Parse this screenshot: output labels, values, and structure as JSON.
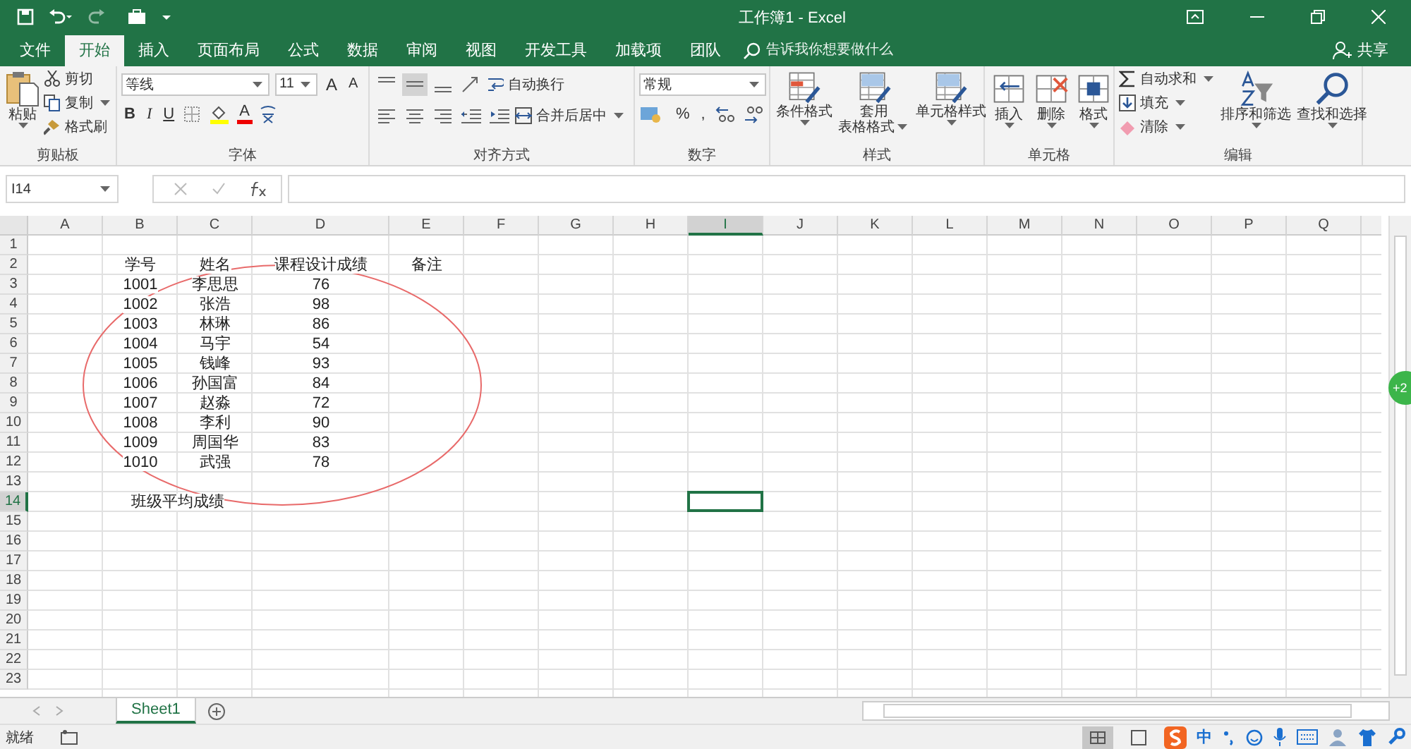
{
  "title_bar": {
    "title": "工作簿1  -  Excel"
  },
  "ribbon_tabs": [
    {
      "label": "文件",
      "selected": false
    },
    {
      "label": "开始",
      "selected": true
    },
    {
      "label": "插入",
      "selected": false
    },
    {
      "label": "页面布局",
      "selected": false
    },
    {
      "label": "公式",
      "selected": false
    },
    {
      "label": "数据",
      "selected": false
    },
    {
      "label": "审阅",
      "selected": false
    },
    {
      "label": "视图",
      "selected": false
    },
    {
      "label": "开发工具",
      "selected": false
    },
    {
      "label": "加载项",
      "selected": false
    },
    {
      "label": "团队",
      "selected": false
    }
  ],
  "tell_me": {
    "placeholder": "告诉我你想要做什么"
  },
  "share": "共享",
  "ribbon": {
    "groups": [
      {
        "kind": "clipboard",
        "label": "剪贴板",
        "big": "粘贴",
        "items": [
          "剪切",
          "复制",
          "格式刷"
        ]
      },
      {
        "kind": "font",
        "label": "字体",
        "font": "等线",
        "size": "11",
        "size_buttons": [
          "A",
          "A"
        ],
        "format_buttons": [
          "B",
          "I",
          "U"
        ],
        "color_button": "A"
      },
      {
        "kind": "alignment",
        "label": "对齐方式",
        "wrap": "自动换行",
        "merge": "合并后居中"
      },
      {
        "kind": "number",
        "label": "数字",
        "format": "常规",
        "percent": "%",
        "comma": ","
      },
      {
        "kind": "styles",
        "label": "样式",
        "buttons": [
          {
            "lines": [
              "条件格式"
            ]
          },
          {
            "lines": [
              "套用",
              "表格格式"
            ]
          },
          {
            "lines": [
              "单元格样式"
            ]
          }
        ]
      },
      {
        "kind": "cells",
        "label": "单元格",
        "buttons": [
          "插入",
          "删除",
          "格式"
        ]
      },
      {
        "kind": "editing",
        "label": "编辑",
        "items": [
          "自动求和",
          "填充",
          "清除"
        ],
        "buttons": [
          "排序和筛选",
          "查找和选择"
        ]
      }
    ]
  },
  "formula_bar": {
    "name_box": "I14"
  },
  "columns": [
    {
      "label": "A",
      "selected": false
    },
    {
      "label": "B",
      "selected": false
    },
    {
      "label": "C",
      "selected": false
    },
    {
      "label": "D",
      "selected": false
    },
    {
      "label": "E",
      "selected": false
    },
    {
      "label": "F",
      "selected": false
    },
    {
      "label": "G",
      "selected": false
    },
    {
      "label": "H",
      "selected": false
    },
    {
      "label": "I",
      "selected": true
    },
    {
      "label": "J",
      "selected": false
    },
    {
      "label": "K",
      "selected": false
    },
    {
      "label": "L",
      "selected": false
    },
    {
      "label": "M",
      "selected": false
    },
    {
      "label": "N",
      "selected": false
    },
    {
      "label": "O",
      "selected": false
    },
    {
      "label": "P",
      "selected": false
    },
    {
      "label": "Q",
      "selected": false
    }
  ],
  "rows": [
    {
      "label": "1",
      "selected": false,
      "cells": {}
    },
    {
      "label": "2",
      "selected": false,
      "cells": {
        "B": "学号",
        "C": "姓名",
        "D": "课程设计成绩",
        "E": "备注"
      }
    },
    {
      "label": "3",
      "selected": false,
      "cells": {
        "B": "1001",
        "C": "李思思",
        "D": "76"
      }
    },
    {
      "label": "4",
      "selected": false,
      "cells": {
        "B": "1002",
        "C": "张浩",
        "D": "98"
      }
    },
    {
      "label": "5",
      "selected": false,
      "cells": {
        "B": "1003",
        "C": "林琳",
        "D": "86"
      }
    },
    {
      "label": "6",
      "selected": false,
      "cells": {
        "B": "1004",
        "C": "马宇",
        "D": "54"
      }
    },
    {
      "label": "7",
      "selected": false,
      "cells": {
        "B": "1005",
        "C": "钱峰",
        "D": "93"
      }
    },
    {
      "label": "8",
      "selected": false,
      "cells": {
        "B": "1006",
        "C": "孙国富",
        "D": "84"
      }
    },
    {
      "label": "9",
      "selected": false,
      "cells": {
        "B": "1007",
        "C": "赵淼",
        "D": "72"
      }
    },
    {
      "label": "10",
      "selected": false,
      "cells": {
        "B": "1008",
        "C": "李利",
        "D": "90"
      }
    },
    {
      "label": "11",
      "selected": false,
      "cells": {
        "B": "1009",
        "C": "周国华",
        "D": "83"
      }
    },
    {
      "label": "12",
      "selected": false,
      "cells": {
        "B": "1010",
        "C": "武强",
        "D": "78"
      }
    },
    {
      "label": "13",
      "selected": false,
      "cells": {}
    },
    {
      "label": "14",
      "selected": true,
      "merged": true,
      "cells": {
        "B": "班级平均成绩"
      }
    },
    {
      "label": "15",
      "selected": false,
      "cells": {}
    },
    {
      "label": "16",
      "selected": false,
      "cells": {}
    },
    {
      "label": "17",
      "selected": false,
      "cells": {}
    },
    {
      "label": "18",
      "selected": false,
      "cells": {}
    },
    {
      "label": "19",
      "selected": false,
      "cells": {}
    },
    {
      "label": "20",
      "selected": false,
      "cells": {}
    },
    {
      "label": "21",
      "selected": false,
      "cells": {}
    },
    {
      "label": "22",
      "selected": false,
      "cells": {}
    },
    {
      "label": "23",
      "selected": false,
      "cells": {}
    }
  ],
  "floating_badge": "+2",
  "sheet_tabs": [
    {
      "label": "Sheet1",
      "selected": true
    }
  ],
  "status_bar": {
    "status": "就绪",
    "ime": "中"
  }
}
